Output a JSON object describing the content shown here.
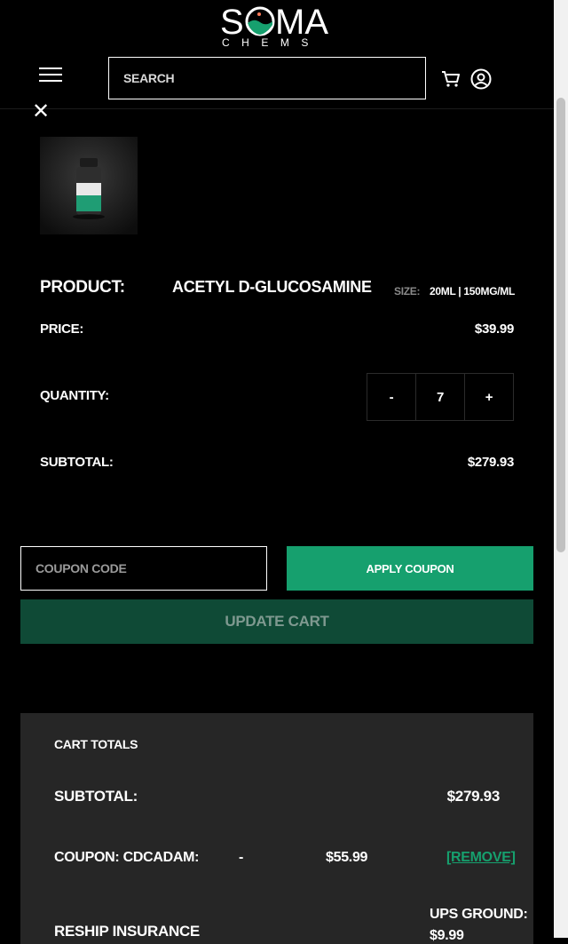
{
  "header": {
    "logo_text": "S  MA",
    "logo_sub": "CHEMS",
    "search_placeholder": "SEARCH"
  },
  "icons": {
    "menu": "hamburger-icon",
    "cart": "cart-icon",
    "account": "user-circle-icon",
    "close": "close-icon"
  },
  "close_label": "✕",
  "item": {
    "product_label": "PRODUCT:",
    "product_name": "ACETYL D-GLUCOSAMINE",
    "size_label": "SIZE:",
    "size_value": "20ML | 150MG/ML",
    "price_label": "PRICE:",
    "price_value": "$39.99",
    "quantity_label": "QUANTITY:",
    "qty_minus": "-",
    "qty_value": "7",
    "qty_plus": "+",
    "subtotal_label": "SUBTOTAL:",
    "subtotal_value": "$279.93"
  },
  "coupon": {
    "placeholder": "COUPON CODE",
    "apply_label": "APPLY COUPON",
    "update_label": "UPDATE CART"
  },
  "totals": {
    "title": "CART TOTALS",
    "subtotal_label": "SUBTOTAL:",
    "subtotal_value": "$279.93",
    "coupon_label": "COUPON: CDCADAM:",
    "coupon_dash": "-",
    "coupon_value": "$55.99",
    "coupon_remove": "[REMOVE]",
    "reship_label": "RESHIP INSURANCE",
    "ups_label": "UPS GROUND:",
    "ups_value": "$9.99"
  },
  "colors": {
    "accent": "#16a06e",
    "accent_dark": "#0f4a36",
    "panel": "#262626"
  }
}
